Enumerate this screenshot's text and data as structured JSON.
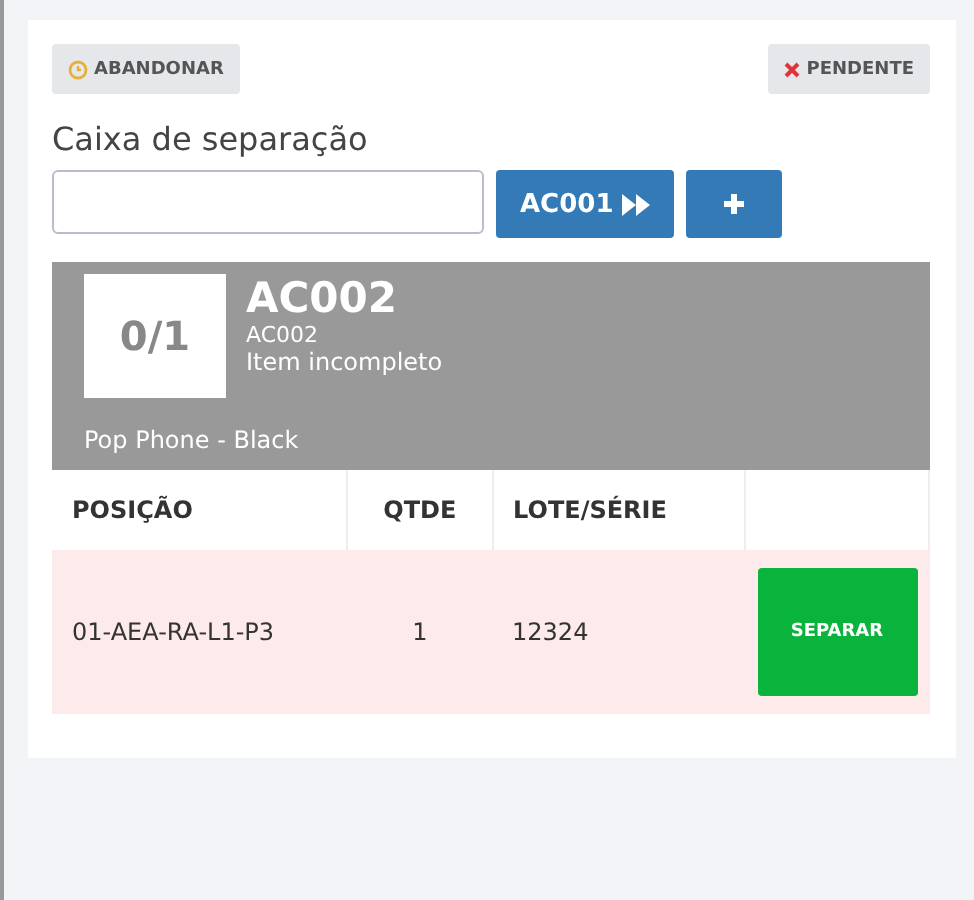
{
  "actions": [
    {
      "kind": "abandon",
      "label": "ABANDONAR"
    },
    {
      "kind": "pending",
      "label": "PENDENTE"
    }
  ],
  "box": {
    "label": "Caixa de separação",
    "next_label": "AC001"
  },
  "item": {
    "count": "0/1",
    "code": "AC002",
    "subcode": "AC002",
    "status": "Item incompleto",
    "name": "Pop Phone - Black"
  },
  "table": {
    "columns": [
      "POSIÇÃO",
      "QTDE",
      "LOTE/SÉRIE"
    ],
    "rows": [
      {
        "position": "01-AEA-RA-L1-P3",
        "qty": "1",
        "lot": "12324",
        "action": "SEPARAR"
      }
    ]
  }
}
